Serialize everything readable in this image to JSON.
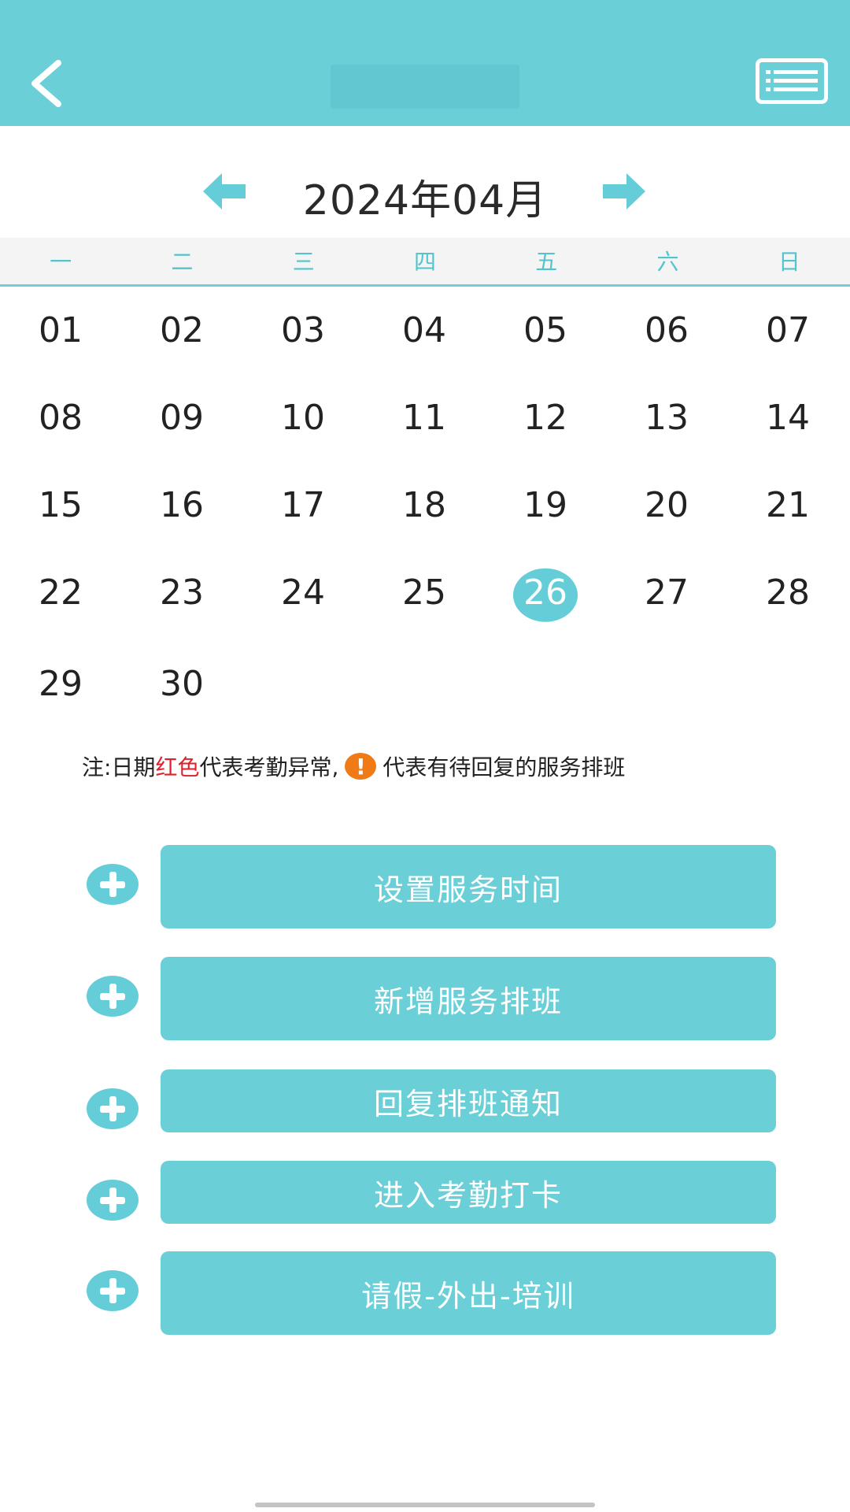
{
  "header": {
    "title": ""
  },
  "month_nav": {
    "label": "2024年04月"
  },
  "weekdays": [
    "一",
    "二",
    "三",
    "四",
    "五",
    "六",
    "日"
  ],
  "days": [
    "01",
    "02",
    "03",
    "04",
    "05",
    "06",
    "07",
    "08",
    "09",
    "10",
    "11",
    "12",
    "13",
    "14",
    "15",
    "16",
    "17",
    "18",
    "19",
    "20",
    "21",
    "22",
    "23",
    "24",
    "25",
    "26",
    "27",
    "28",
    "29",
    "30"
  ],
  "selected_day": "26",
  "note": {
    "prefix": "注:日期",
    "red_word": "红色",
    "middle": "代表考勤异常,",
    "icon_glyph": "!",
    "suffix": "代表有待回复的服务排班"
  },
  "actions": [
    {
      "label": "设置服务时间"
    },
    {
      "label": "新增服务排班"
    },
    {
      "label": "回复排班通知"
    },
    {
      "label": "进入考勤打卡"
    },
    {
      "label": "请假-外出-培训"
    }
  ],
  "colors": {
    "accent": "#6bcfd8",
    "red": "#e0202a",
    "warning": "#f07a16"
  }
}
